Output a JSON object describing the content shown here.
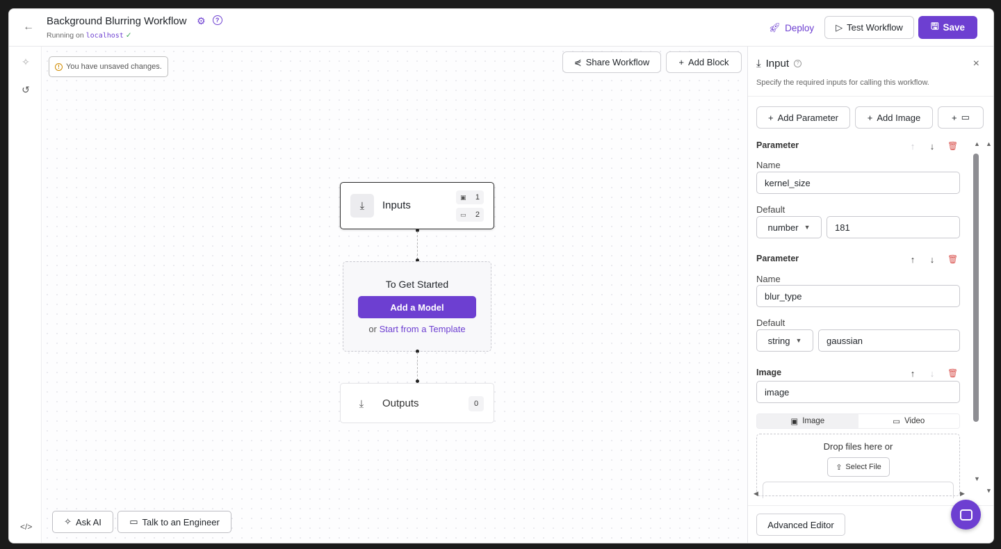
{
  "header": {
    "title": "Background Blurring Workflow",
    "running_prefix": "Running on",
    "host": "localhost",
    "deploy_label": "Deploy",
    "test_label": "Test Workflow",
    "save_label": "Save"
  },
  "canvas": {
    "unsaved_notice": "You have unsaved changes.",
    "share_label": "Share Workflow",
    "add_block_label": "Add Block",
    "inputs_node": {
      "label": "Inputs",
      "image_count": "1",
      "param_count": "2"
    },
    "start_node": {
      "title": "To Get Started",
      "button": "Add a Model",
      "or_text": "or",
      "template_link": "Start from a Template"
    },
    "outputs_node": {
      "label": "Outputs",
      "count": "0"
    },
    "ask_ai_label": "Ask AI",
    "talk_engineer_label": "Talk to an Engineer"
  },
  "panel": {
    "title": "Input",
    "description": "Specify the required inputs for calling this workflow.",
    "add_parameter": "Add Parameter",
    "add_image": "Add Image",
    "param1": {
      "section": "Parameter",
      "name_label": "Name",
      "name_value": "kernel_size",
      "default_label": "Default",
      "type": "number",
      "default_value": "181"
    },
    "param2": {
      "section": "Parameter",
      "name_label": "Name",
      "name_value": "blur_type",
      "default_label": "Default",
      "type": "string",
      "default_value": "gaussian"
    },
    "image": {
      "section": "Image",
      "name_value": "image",
      "tab_image": "Image",
      "tab_video": "Video",
      "drop_text": "Drop files here or",
      "select_file": "Select File"
    },
    "advanced_editor": "Advanced Editor"
  },
  "colors": {
    "accent": "#6d3fd1",
    "danger": "#d9534f",
    "success": "#3aa34f"
  }
}
